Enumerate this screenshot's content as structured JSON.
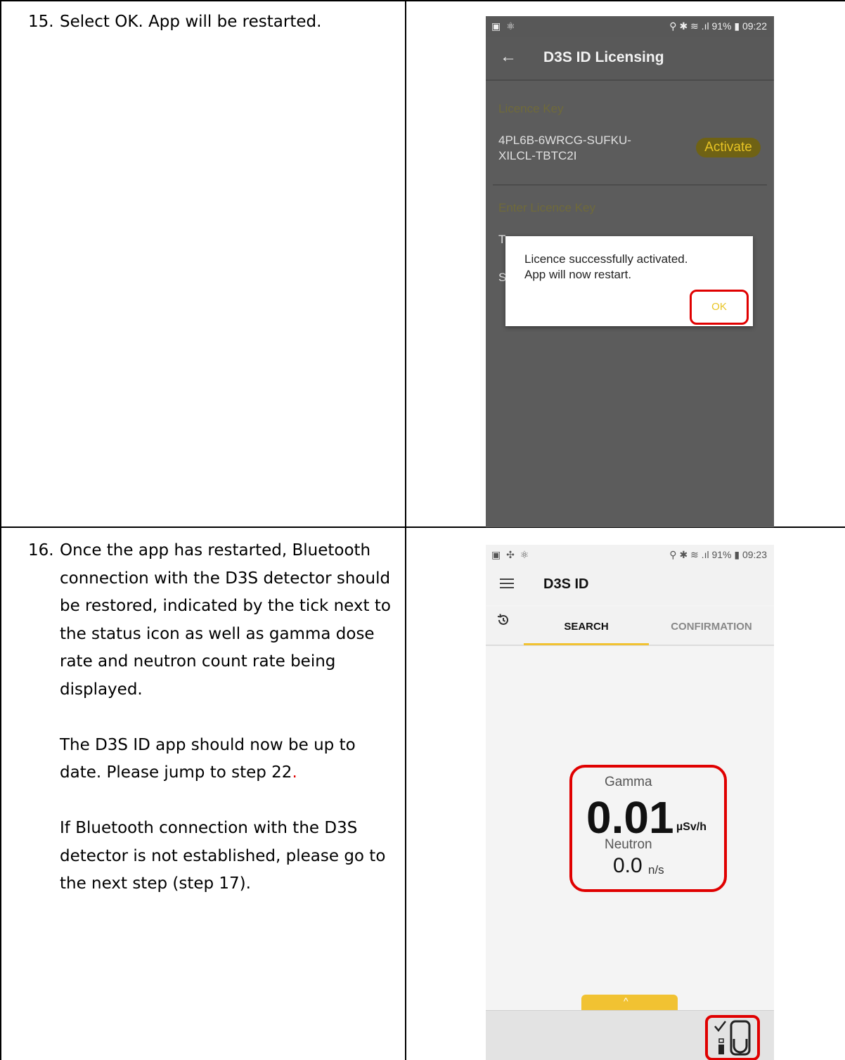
{
  "steps": [
    {
      "number": "15.",
      "paragraphs": [
        "Select OK. App will be restarted."
      ]
    },
    {
      "number": "16.",
      "paragraph1": "Once the app has restarted, Bluetooth connection with the D3S detector should be restored, indicated by the tick next to the status icon as well as gamma dose rate and neutron count rate being displayed.",
      "paragraph2": "The D3S ID app should now be up to date. Please jump to step 22",
      "paragraph2_end": ".",
      "paragraph3": "If Bluetooth connection with the D3S detector is not established, please go to the next step (step 17)."
    }
  ],
  "screen1": {
    "status_left": "▣ ⚛",
    "status_right": "⚲ ✱ ≋ .ıl 91% ▮ 09:22",
    "back_arrow": "←",
    "title": "D3S ID Licensing",
    "licence_key_label": "Licence Key",
    "licence_key_line1": "4PL6B-6WRCG-SUFKU-",
    "licence_key_line2": "XILCL-TBTC2I",
    "activate_button": "Activate",
    "enter_key_label": "Enter Licence Key",
    "hidden_fragment1": "T",
    "hidden_fragment2": "S",
    "dialog": {
      "line1": "Licence successfully activated.",
      "line2": "App will now restart.",
      "ok_button": "OK"
    }
  },
  "screen2": {
    "status_left": "▣ ✣ ⚛",
    "status_right": "⚲ ✱ ≋ .ıl 91% ▮ 09:23",
    "title": "D3S ID",
    "tabs": {
      "search": "SEARCH",
      "confirmation": "CONFIRMATION"
    },
    "gamma_label": "Gamma",
    "gamma_value": "0.01",
    "gamma_unit": "µSv/h",
    "neutron_label": "Neutron",
    "neutron_value": "0.0",
    "neutron_unit": "n/s",
    "pull_up": "^",
    "connected_tick": "✓"
  },
  "colors": {
    "accent_yellow": "#f1c232",
    "highlight_red": "#e00000"
  }
}
